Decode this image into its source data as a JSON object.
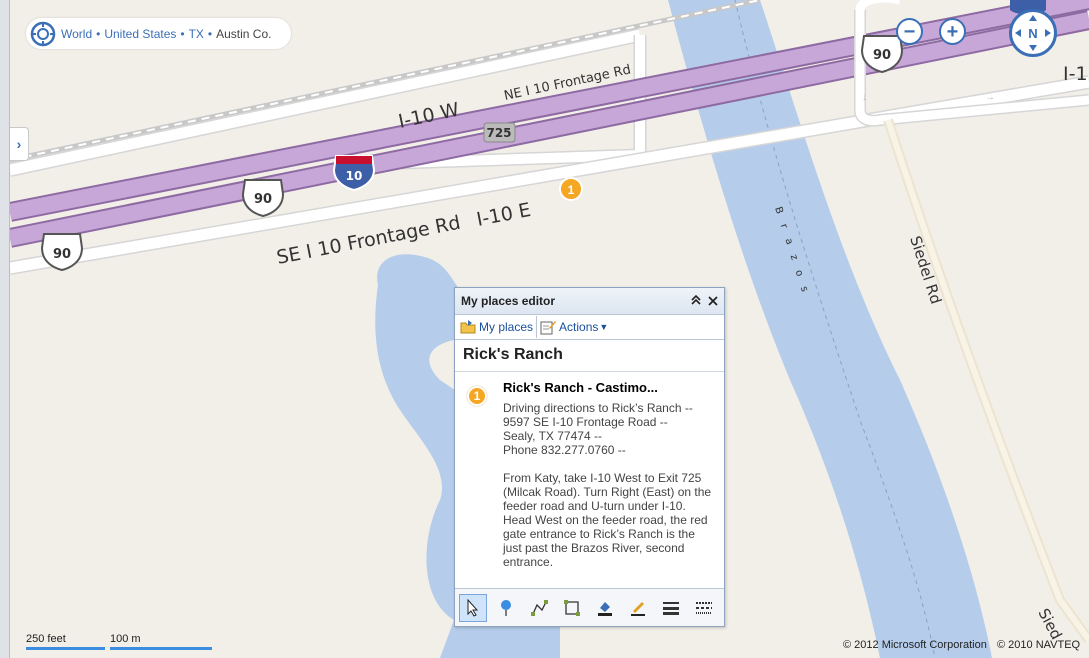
{
  "breadcrumb": {
    "items": [
      {
        "label": "World",
        "link": true
      },
      {
        "label": "United States",
        "link": true
      },
      {
        "label": "TX",
        "link": true
      },
      {
        "label": "Austin Co.",
        "link": false
      }
    ],
    "separator": "•"
  },
  "controls": {
    "expand_label": "›",
    "zoom_out_label": "−",
    "zoom_in_label": "+",
    "compass_north": "N"
  },
  "map": {
    "road_labels": {
      "i10_west": "I-10 W",
      "ne_frontage": "NE I 10 Frontage Rd",
      "se_frontage": "SE I 10 Frontage Rd",
      "i10_east": "I-10 E",
      "siedel": "Siedel Rd",
      "siedel_cut": "Sied",
      "brazos": "Brazos",
      "i10_right": "I-1"
    },
    "shields": {
      "us90": "90",
      "interstate": "10",
      "exit": "725"
    },
    "pushpin_number": "1",
    "colors": {
      "land": "#f2efe9",
      "water": "#b5cdeb",
      "highway": "#c7a6d8",
      "highway_border": "#8e6aa2",
      "road": "#ffffff"
    }
  },
  "scale": {
    "feet": "250 feet",
    "meters": "100 m"
  },
  "copyright": {
    "microsoft": "© 2012 Microsoft Corporation",
    "navteq": "© 2010 NAVTEQ"
  },
  "panel": {
    "title": "My places editor",
    "toolbar": {
      "my_places": "My places",
      "actions": "Actions"
    },
    "collection_title": "Rick's Ranch",
    "entry": {
      "number": "1",
      "title": "Rick's Ranch - Castimo...",
      "description": "Driving directions to Rick’s Ranch --\n9597 SE I-10 Frontage Road --\nSealy, TX 77474 --\nPhone 832.277.0760 --\n\nFrom Katy, take I-10 West to Exit 725 (Milcak Road). Turn Right (East) on the feeder road and U-turn under I-10. Head West on the feeder road, the red gate entrance to Rick’s Ranch is the just past the Brazos River, second entrance."
    },
    "tools": [
      "select-icon",
      "pushpin-icon",
      "polyline-icon",
      "polygon-icon",
      "fill-icon",
      "edit-icon",
      "line-weight-icon",
      "line-style-icon"
    ]
  }
}
